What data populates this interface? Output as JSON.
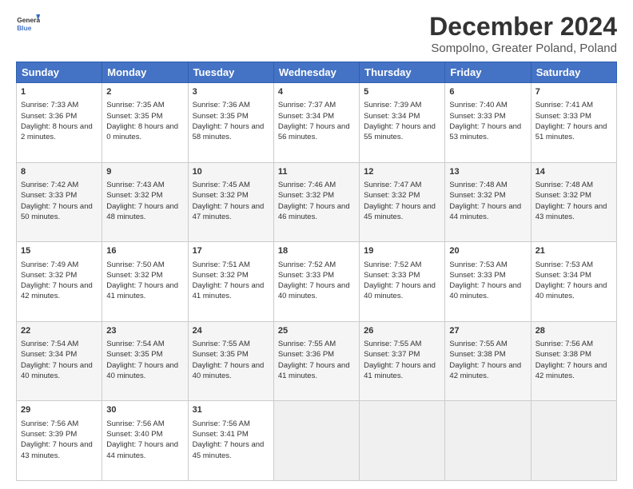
{
  "header": {
    "logo_line1": "General",
    "logo_line2": "Blue",
    "title": "December 2024",
    "subtitle": "Sompolno, Greater Poland, Poland"
  },
  "weekdays": [
    "Sunday",
    "Monday",
    "Tuesday",
    "Wednesday",
    "Thursday",
    "Friday",
    "Saturday"
  ],
  "weeks": [
    [
      {
        "day": "1",
        "rise": "Sunrise: 7:33 AM",
        "set": "Sunset: 3:36 PM",
        "daylight": "Daylight: 8 hours and 2 minutes."
      },
      {
        "day": "2",
        "rise": "Sunrise: 7:35 AM",
        "set": "Sunset: 3:35 PM",
        "daylight": "Daylight: 8 hours and 0 minutes."
      },
      {
        "day": "3",
        "rise": "Sunrise: 7:36 AM",
        "set": "Sunset: 3:35 PM",
        "daylight": "Daylight: 7 hours and 58 minutes."
      },
      {
        "day": "4",
        "rise": "Sunrise: 7:37 AM",
        "set": "Sunset: 3:34 PM",
        "daylight": "Daylight: 7 hours and 56 minutes."
      },
      {
        "day": "5",
        "rise": "Sunrise: 7:39 AM",
        "set": "Sunset: 3:34 PM",
        "daylight": "Daylight: 7 hours and 55 minutes."
      },
      {
        "day": "6",
        "rise": "Sunrise: 7:40 AM",
        "set": "Sunset: 3:33 PM",
        "daylight": "Daylight: 7 hours and 53 minutes."
      },
      {
        "day": "7",
        "rise": "Sunrise: 7:41 AM",
        "set": "Sunset: 3:33 PM",
        "daylight": "Daylight: 7 hours and 51 minutes."
      }
    ],
    [
      {
        "day": "8",
        "rise": "Sunrise: 7:42 AM",
        "set": "Sunset: 3:33 PM",
        "daylight": "Daylight: 7 hours and 50 minutes."
      },
      {
        "day": "9",
        "rise": "Sunrise: 7:43 AM",
        "set": "Sunset: 3:32 PM",
        "daylight": "Daylight: 7 hours and 48 minutes."
      },
      {
        "day": "10",
        "rise": "Sunrise: 7:45 AM",
        "set": "Sunset: 3:32 PM",
        "daylight": "Daylight: 7 hours and 47 minutes."
      },
      {
        "day": "11",
        "rise": "Sunrise: 7:46 AM",
        "set": "Sunset: 3:32 PM",
        "daylight": "Daylight: 7 hours and 46 minutes."
      },
      {
        "day": "12",
        "rise": "Sunrise: 7:47 AM",
        "set": "Sunset: 3:32 PM",
        "daylight": "Daylight: 7 hours and 45 minutes."
      },
      {
        "day": "13",
        "rise": "Sunrise: 7:48 AM",
        "set": "Sunset: 3:32 PM",
        "daylight": "Daylight: 7 hours and 44 minutes."
      },
      {
        "day": "14",
        "rise": "Sunrise: 7:48 AM",
        "set": "Sunset: 3:32 PM",
        "daylight": "Daylight: 7 hours and 43 minutes."
      }
    ],
    [
      {
        "day": "15",
        "rise": "Sunrise: 7:49 AM",
        "set": "Sunset: 3:32 PM",
        "daylight": "Daylight: 7 hours and 42 minutes."
      },
      {
        "day": "16",
        "rise": "Sunrise: 7:50 AM",
        "set": "Sunset: 3:32 PM",
        "daylight": "Daylight: 7 hours and 41 minutes."
      },
      {
        "day": "17",
        "rise": "Sunrise: 7:51 AM",
        "set": "Sunset: 3:32 PM",
        "daylight": "Daylight: 7 hours and 41 minutes."
      },
      {
        "day": "18",
        "rise": "Sunrise: 7:52 AM",
        "set": "Sunset: 3:33 PM",
        "daylight": "Daylight: 7 hours and 40 minutes."
      },
      {
        "day": "19",
        "rise": "Sunrise: 7:52 AM",
        "set": "Sunset: 3:33 PM",
        "daylight": "Daylight: 7 hours and 40 minutes."
      },
      {
        "day": "20",
        "rise": "Sunrise: 7:53 AM",
        "set": "Sunset: 3:33 PM",
        "daylight": "Daylight: 7 hours and 40 minutes."
      },
      {
        "day": "21",
        "rise": "Sunrise: 7:53 AM",
        "set": "Sunset: 3:34 PM",
        "daylight": "Daylight: 7 hours and 40 minutes."
      }
    ],
    [
      {
        "day": "22",
        "rise": "Sunrise: 7:54 AM",
        "set": "Sunset: 3:34 PM",
        "daylight": "Daylight: 7 hours and 40 minutes."
      },
      {
        "day": "23",
        "rise": "Sunrise: 7:54 AM",
        "set": "Sunset: 3:35 PM",
        "daylight": "Daylight: 7 hours and 40 minutes."
      },
      {
        "day": "24",
        "rise": "Sunrise: 7:55 AM",
        "set": "Sunset: 3:35 PM",
        "daylight": "Daylight: 7 hours and 40 minutes."
      },
      {
        "day": "25",
        "rise": "Sunrise: 7:55 AM",
        "set": "Sunset: 3:36 PM",
        "daylight": "Daylight: 7 hours and 41 minutes."
      },
      {
        "day": "26",
        "rise": "Sunrise: 7:55 AM",
        "set": "Sunset: 3:37 PM",
        "daylight": "Daylight: 7 hours and 41 minutes."
      },
      {
        "day": "27",
        "rise": "Sunrise: 7:55 AM",
        "set": "Sunset: 3:38 PM",
        "daylight": "Daylight: 7 hours and 42 minutes."
      },
      {
        "day": "28",
        "rise": "Sunrise: 7:56 AM",
        "set": "Sunset: 3:38 PM",
        "daylight": "Daylight: 7 hours and 42 minutes."
      }
    ],
    [
      {
        "day": "29",
        "rise": "Sunrise: 7:56 AM",
        "set": "Sunset: 3:39 PM",
        "daylight": "Daylight: 7 hours and 43 minutes."
      },
      {
        "day": "30",
        "rise": "Sunrise: 7:56 AM",
        "set": "Sunset: 3:40 PM",
        "daylight": "Daylight: 7 hours and 44 minutes."
      },
      {
        "day": "31",
        "rise": "Sunrise: 7:56 AM",
        "set": "Sunset: 3:41 PM",
        "daylight": "Daylight: 7 hours and 45 minutes."
      },
      null,
      null,
      null,
      null
    ]
  ]
}
